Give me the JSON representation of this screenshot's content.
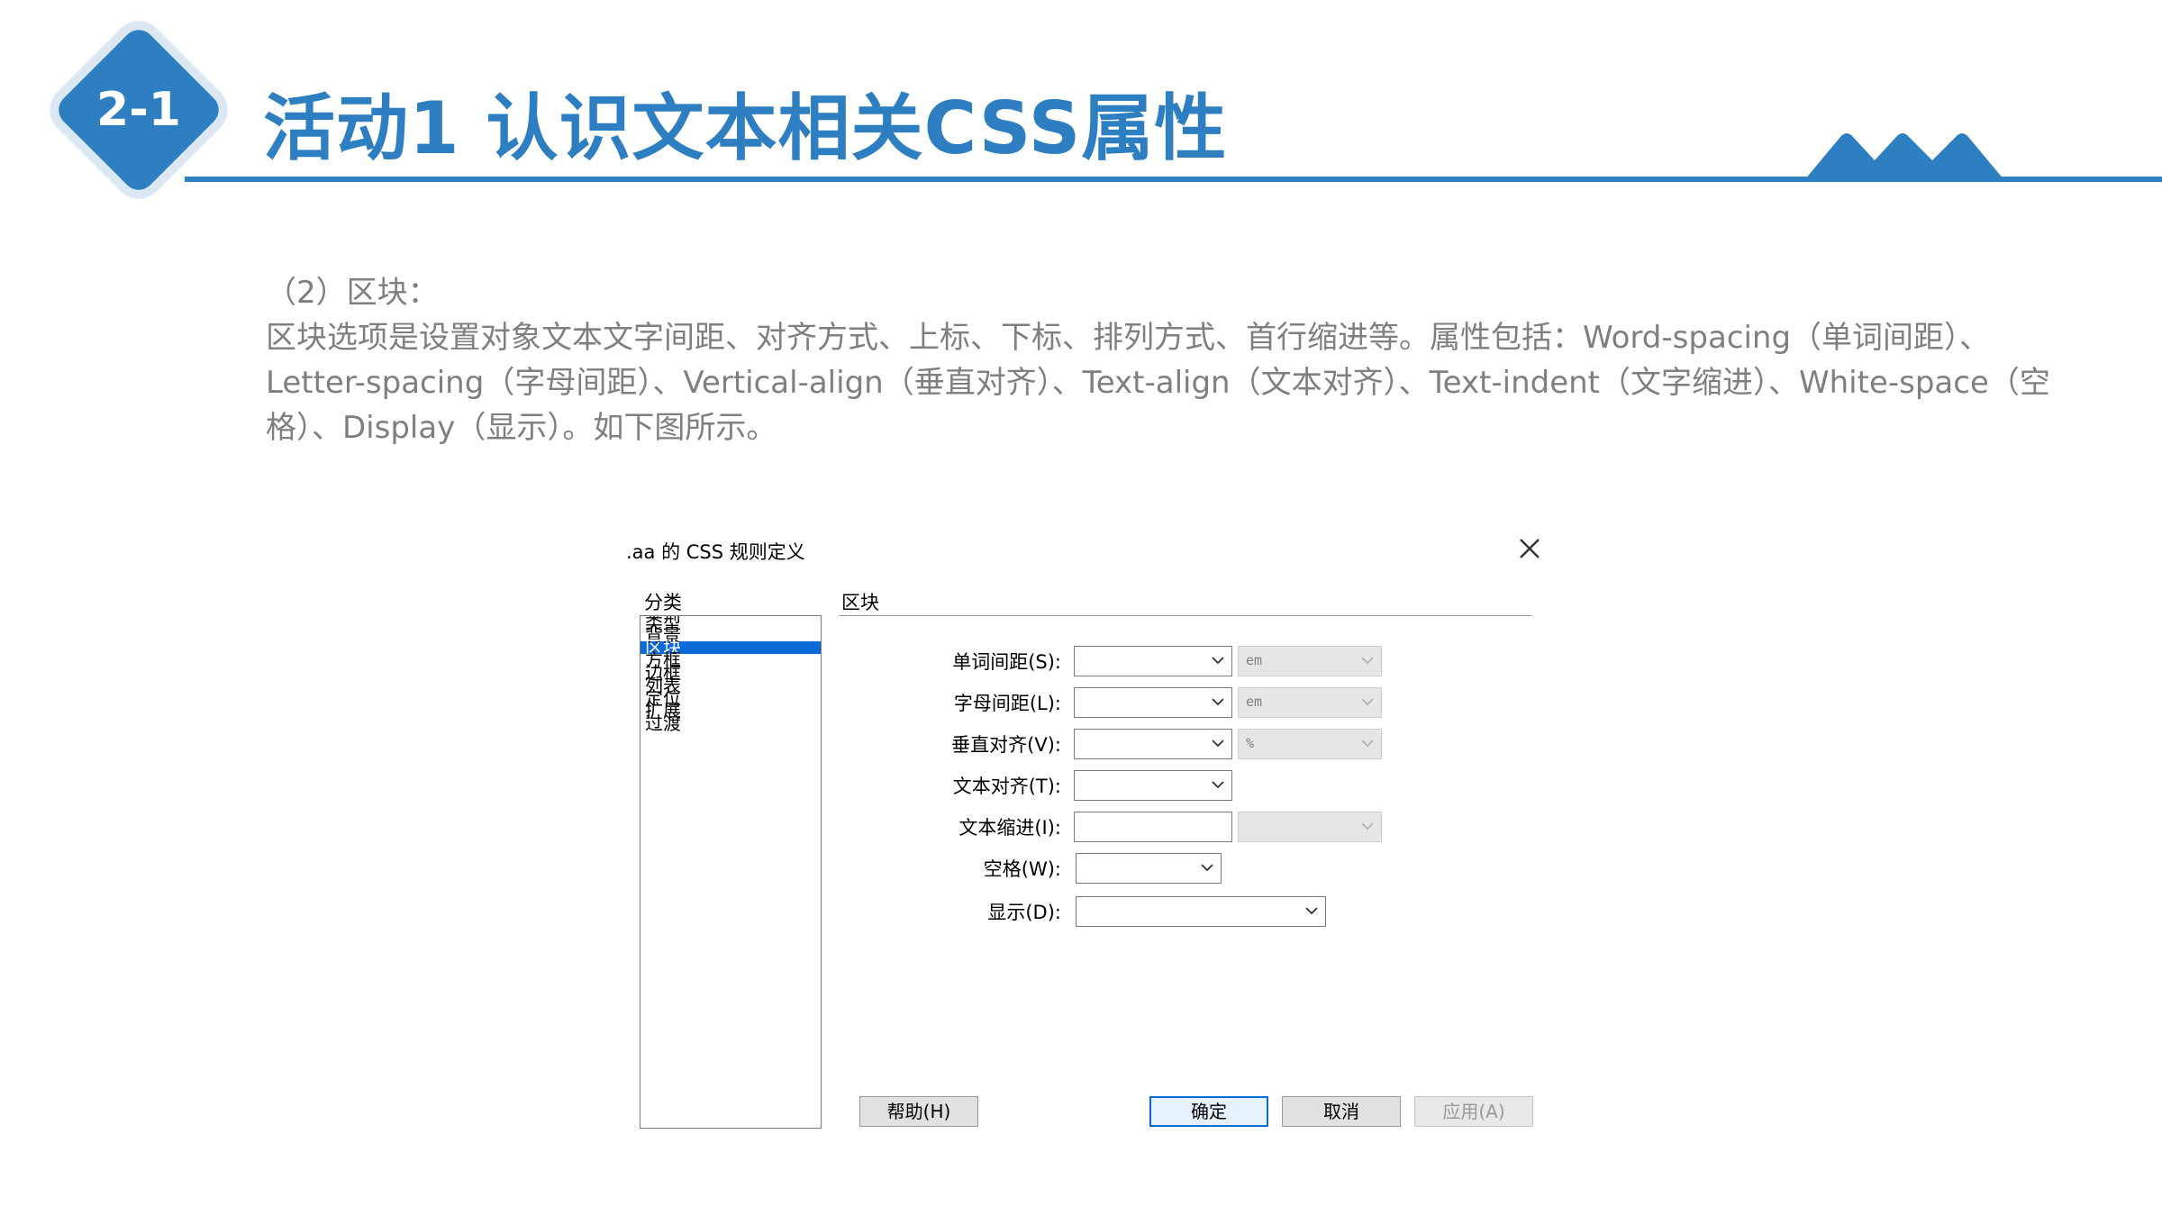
{
  "header": {
    "badge": "2-1",
    "title": "活动1 认识文本相关CSS属性"
  },
  "body": {
    "heading": "（2）区块：",
    "paragraph": "区块选项是设置对象文本文字间距、对齐方式、上标、下标、排列方式、首行缩进等。属性包括：Word-spacing（单词间距）、Letter-spacing（字母间距）、Vertical-align（垂直对齐）、Text-align（文本对齐）、Text-indent（文字缩进）、White-space（空格）、Display（显示）。如下图所示。"
  },
  "dialog": {
    "title": ".aa 的 CSS 规则定义",
    "category_label": "分类",
    "categories": [
      "类型",
      "背景",
      "区块",
      "方框",
      "边框",
      "列表",
      "定位",
      "扩展",
      "过渡"
    ],
    "selected_category": "区块",
    "section_label": "区块",
    "fields": {
      "word_spacing": {
        "label": "单词间距(S):",
        "unit": "em"
      },
      "letter_spacing": {
        "label": "字母间距(L):",
        "unit": "em"
      },
      "vertical_align": {
        "label": "垂直对齐(V):",
        "unit": "%"
      },
      "text_align": {
        "label": "文本对齐(T):"
      },
      "text_indent": {
        "label": "文本缩进(I):"
      },
      "white_space": {
        "label": "空格(W):"
      },
      "display": {
        "label": "显示(D):"
      }
    },
    "buttons": {
      "help": "帮助(H)",
      "ok": "确定",
      "cancel": "取消",
      "apply": "应用(A)"
    }
  },
  "colors": {
    "accent": "#2e7fc1",
    "selection": "#0a6ad6",
    "body_text": "#7f7f7f"
  }
}
